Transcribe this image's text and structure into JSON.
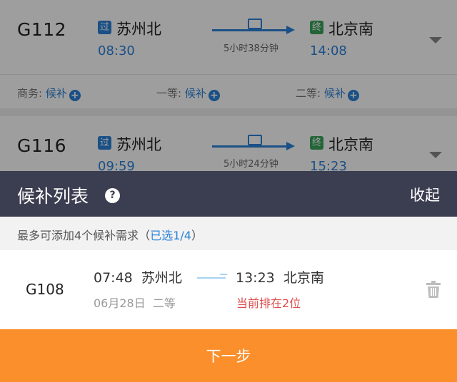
{
  "background": {
    "trains": [
      {
        "number": "G112",
        "from_badge": "过",
        "from_station": "苏州北",
        "from_time": "08:30",
        "duration": "5小时38分钟",
        "to_badge": "终",
        "to_station": "北京南",
        "to_time": "14:08",
        "seats": [
          {
            "label": "商务:",
            "action": "候补"
          },
          {
            "label": "一等:",
            "action": "候补"
          },
          {
            "label": "二等:",
            "action": "候补"
          }
        ]
      },
      {
        "number": "G116",
        "from_badge": "过",
        "from_station": "苏州北",
        "from_time": "09:59",
        "duration": "5小时24分钟",
        "to_badge": "终",
        "to_station": "北京南",
        "to_time": "15:23"
      }
    ]
  },
  "sheet": {
    "title": "候补列表",
    "help_icon": "question-icon",
    "collapse_label": "收起",
    "notice_prefix": "最多可添加4个候补需求（",
    "notice_selected": "已选1/4",
    "notice_suffix": "）",
    "item": {
      "train": "G108",
      "dep_time": "07:48",
      "dep_station": "苏州北",
      "arr_time": "13:23",
      "arr_station": "北京南",
      "date": "06月28日",
      "seat_class": "二等",
      "status": "当前排在2位"
    },
    "next_label": "下一步"
  },
  "colors": {
    "accent": "#2b82d9",
    "header": "#3b3d50",
    "button": "#fa8f2b",
    "status": "#e04e4e"
  }
}
